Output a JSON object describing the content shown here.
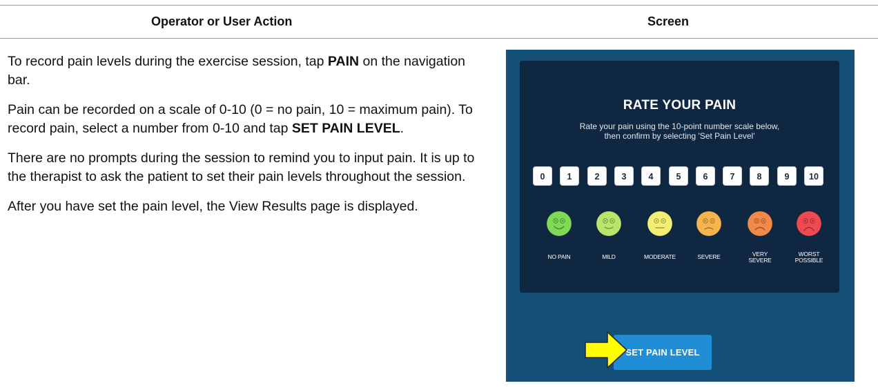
{
  "table": {
    "header_left": "Operator or User Action",
    "header_right": "Screen"
  },
  "instructions": {
    "p1_text": "To record pain levels during the exercise session, tap ",
    "p1_bold": "PAIN",
    "p1_tail": " on the navigation bar.",
    "p2_text": "Pain can be recorded on a scale of 0-10 (0 = no pain, 10 = maximum pain). To record pain, select a number from 0-10 and tap ",
    "p2_bold": "SET PAIN LEVEL",
    "p2_tail": ".",
    "p3": "There are no prompts during the session to remind you to input pain. It is up to the therapist to ask the patient to set their pain levels throughout the session.",
    "p4": "After you have set the pain level, the View Results page is displayed."
  },
  "screen": {
    "title": "RATE YOUR PAIN",
    "subtitle_line1": "Rate your pain using the 10-point number scale below,",
    "subtitle_line2": "then confirm by selecting 'Set Pain Level'",
    "numbers": [
      "0",
      "1",
      "2",
      "3",
      "4",
      "5",
      "6",
      "7",
      "8",
      "9",
      "10"
    ],
    "faces": [
      {
        "label": "NO PAIN",
        "color": "#7ed957",
        "icon": "no-pain-face-icon"
      },
      {
        "label": "MILD",
        "color": "#b8e66a",
        "icon": "mild-face-icon"
      },
      {
        "label": "MODERATE",
        "color": "#f3ef73",
        "icon": "moderate-face-icon"
      },
      {
        "label": "SEVERE",
        "color": "#f6b44e",
        "icon": "severe-face-icon"
      },
      {
        "label": "VERY\nSEVERE",
        "color": "#f2894a",
        "icon": "very-severe-face-icon"
      },
      {
        "label": "WORST\nPOSSIBLE",
        "color": "#ee4a4f",
        "icon": "worst-possible-face-icon"
      }
    ],
    "set_button": "SET PAIN LEVEL",
    "colors": {
      "screen_bg": "#145078",
      "panel_bg": "#0f2740",
      "button_bg": "#1f8ed6",
      "arrow_fill": "#ffff00"
    }
  }
}
